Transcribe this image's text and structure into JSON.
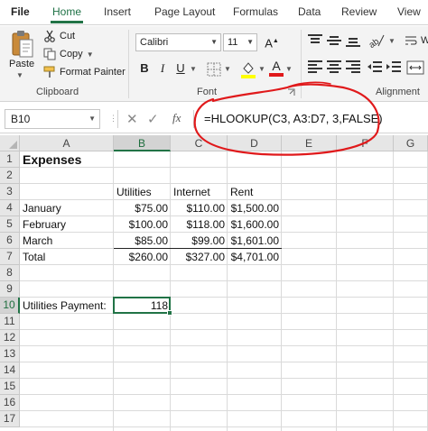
{
  "tabs": [
    "File",
    "Home",
    "Insert",
    "Page Layout",
    "Formulas",
    "Data",
    "Review",
    "View"
  ],
  "ribbon": {
    "clipboard": {
      "paste_label": "Paste",
      "cut_label": "Cut",
      "copy_label": "Copy",
      "format_painter_label": "Format Painter",
      "group_label": "Clipboard"
    },
    "font": {
      "font_name": "Calibri",
      "font_size": "11",
      "bold": "B",
      "italic": "I",
      "underline": "U",
      "font_color_glyph": "A",
      "grow_glyph": "A",
      "group_label": "Font"
    },
    "alignment": {
      "wrap_label": "W",
      "group_label": "Alignment"
    }
  },
  "formula_bar": {
    "name_box": "B10",
    "fx": "fx",
    "formula": "=HLOOKUP(C3, A3:D7, 3,FALSE)"
  },
  "sheet": {
    "columns": [
      "A",
      "B",
      "C",
      "D",
      "E",
      "F",
      "G"
    ],
    "rows": [
      "1",
      "2",
      "3",
      "4",
      "5",
      "6",
      "7",
      "8",
      "9",
      "10",
      "11",
      "12",
      "13",
      "14",
      "15",
      "16",
      "17"
    ],
    "selected_column": "B",
    "selected_row": "10",
    "cells": {
      "A1": "Expenses",
      "B3": "Utilities",
      "C3": "Internet",
      "D3": "Rent",
      "A4": "January",
      "B4": "$75.00",
      "C4": "$110.00",
      "D4": "$1,500.00",
      "A5": "February",
      "B5": "$100.00",
      "C5": "$118.00",
      "D5": "$1,600.00",
      "A6": "March",
      "B6": "$85.00",
      "C6": "$99.00",
      "D6": "$1,601.00",
      "A7": "Total",
      "B7": "$260.00",
      "C7": "$327.00",
      "D7": "$4,701.00",
      "A10": "Utilities Payment:",
      "B10": "118"
    }
  },
  "colors": {
    "accent": "#217346",
    "annotation": "#e0191b"
  }
}
